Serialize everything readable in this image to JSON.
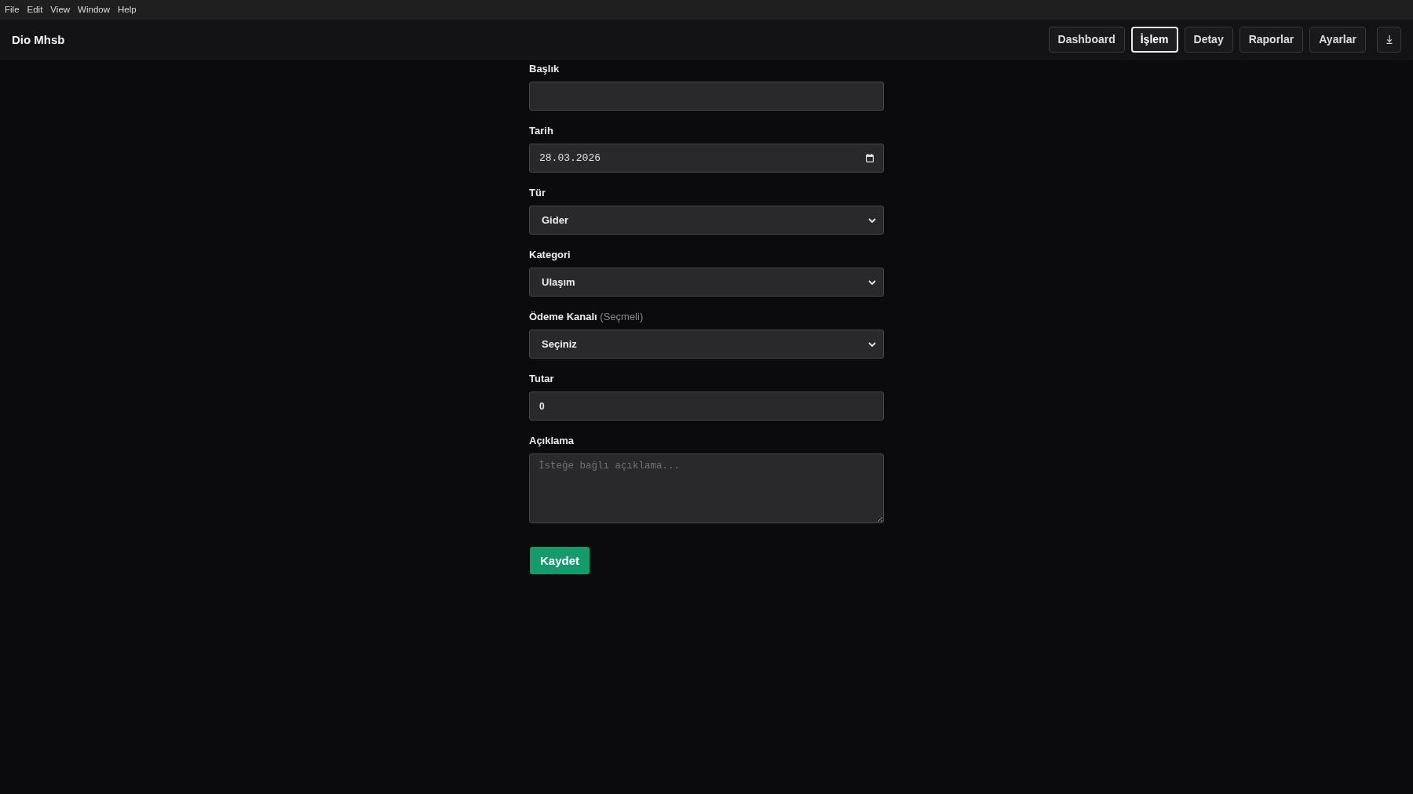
{
  "menu_bar": [
    "File",
    "Edit",
    "View",
    "Window",
    "Help"
  ],
  "header": {
    "title": "Dio Mhsb",
    "nav": [
      {
        "label": "Dashboard",
        "selected": false
      },
      {
        "label": "İşlem",
        "selected": true
      },
      {
        "label": "Detay",
        "selected": false
      },
      {
        "label": "Raporlar",
        "selected": false
      },
      {
        "label": "Ayarlar",
        "selected": false
      }
    ]
  },
  "form": {
    "fields": [
      {
        "kind": "text",
        "label": "Başlık"
      },
      {
        "kind": "date",
        "label": "Tarih",
        "value": "28.03.2026"
      },
      {
        "kind": "select",
        "label": "Tür",
        "value": "Gider"
      },
      {
        "kind": "select",
        "label": "Kategori",
        "value": "Ulaşım"
      },
      {
        "kind": "select",
        "label": "Ödeme Kanalı",
        "hint": "(Seçmeli)",
        "value": "Seçiniz"
      },
      {
        "kind": "number",
        "label": "Tutar",
        "value": "0"
      },
      {
        "kind": "textarea",
        "label": "Açıklama",
        "placeholder": "İsteğe bağlı açıklama..."
      }
    ],
    "submit": "Kaydet"
  }
}
